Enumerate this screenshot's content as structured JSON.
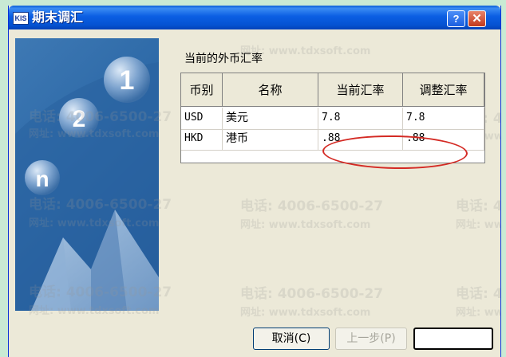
{
  "window": {
    "app_icon": "KIS",
    "title": "期末调汇",
    "help_button": "?",
    "close_button": "✕"
  },
  "side_panel": {
    "badge_1": "1",
    "badge_2": "2",
    "badge_n": "n"
  },
  "section": {
    "label": "当前的外币汇率"
  },
  "table": {
    "headers": [
      "币别",
      "名称",
      "当前汇率",
      "调整汇率"
    ],
    "rows": [
      [
        "USD",
        "美元",
        "7.8",
        "7.8"
      ],
      [
        "HKD",
        "港币",
        ".88",
        ".88"
      ]
    ]
  },
  "buttons": {
    "cancel": "取消(C)",
    "back": "上一步(P)",
    "next": ""
  },
  "watermark": {
    "phone": "电话: 4006-6500-27",
    "site": "网址: www.tdxsoft.com"
  },
  "colors": {
    "title_bar": "#0553d3",
    "highlight_oval": "#d42a24",
    "side_panel": "#2e6aa8"
  }
}
